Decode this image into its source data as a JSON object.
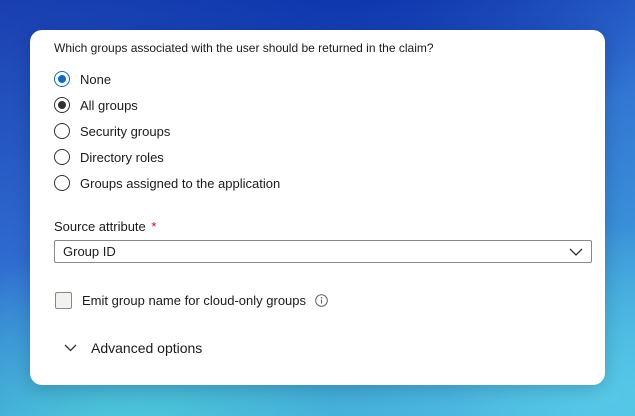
{
  "dialog": {
    "question": "Which groups associated with the user should be returned in the claim?",
    "options": [
      {
        "label": "None",
        "state": "selected"
      },
      {
        "label": "All groups",
        "state": "selected"
      },
      {
        "label": "Security groups",
        "state": "unselected"
      },
      {
        "label": "Directory roles",
        "state": "unselected"
      },
      {
        "label": "Groups assigned to the application",
        "state": "unselected"
      }
    ],
    "source_attribute": {
      "label": "Source attribute",
      "required_marker": "*",
      "value": "Group ID",
      "icon": "chevron-down-icon"
    },
    "emit_checkbox": {
      "label": "Emit group name for cloud-only groups",
      "checked": false,
      "icon": "info-icon"
    },
    "advanced": {
      "label": "Advanced options",
      "icon": "chevron-down-icon"
    }
  },
  "colors": {
    "accent": "#0f6cbd",
    "required": "#c50f1f",
    "text": "#1b1b1b"
  }
}
